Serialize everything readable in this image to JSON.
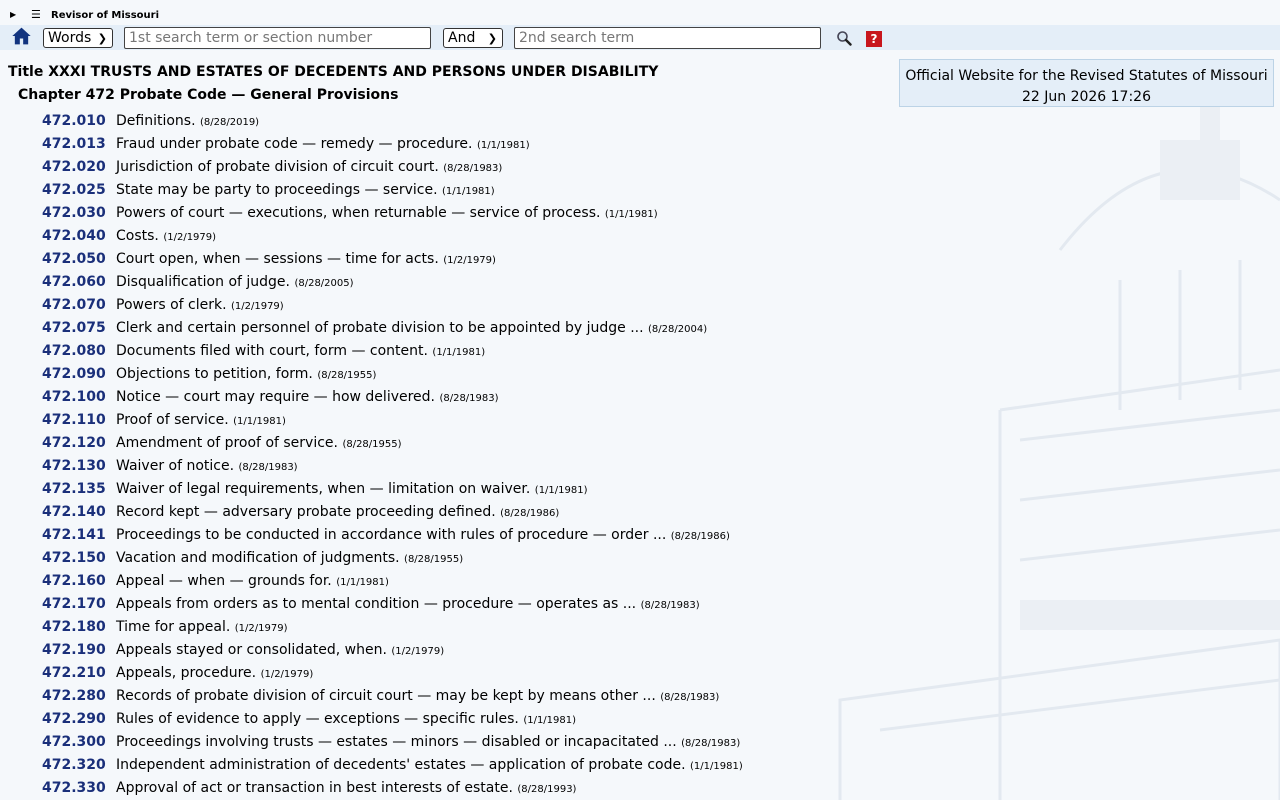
{
  "header": {
    "brand": "Revisor of Missouri"
  },
  "search": {
    "mode_selected": "Words",
    "term1_placeholder": "1st search term or section number",
    "connector_selected": "And",
    "term2_placeholder": "2nd search term",
    "help_label": "?"
  },
  "info": {
    "line1": "Official Website for the Revised Statutes of Missouri",
    "line2": "22 Jun 2026 17:26"
  },
  "title": "Title XXXI TRUSTS AND ESTATES OF DECEDENTS AND PERSONS UNDER DISABILITY",
  "chapter": "Chapter 472 Probate Code — General Provisions",
  "sections": [
    {
      "num": "472.010",
      "desc": "Definitions.",
      "date": "(8/28/2019)"
    },
    {
      "num": "472.013",
      "desc": "Fraud under probate code — remedy — procedure.",
      "date": "(1/1/1981)"
    },
    {
      "num": "472.020",
      "desc": "Jurisdiction of probate division of circuit court.",
      "date": "(8/28/1983)"
    },
    {
      "num": "472.025",
      "desc": "State may be party to proceedings — service.",
      "date": "(1/1/1981)"
    },
    {
      "num": "472.030",
      "desc": "Powers of court — executions, when returnable — service of process.",
      "date": "(1/1/1981)"
    },
    {
      "num": "472.040",
      "desc": "Costs.",
      "date": "(1/2/1979)"
    },
    {
      "num": "472.050",
      "desc": "Court open, when — sessions — time for acts.",
      "date": "(1/2/1979)"
    },
    {
      "num": "472.060",
      "desc": "Disqualification of judge.",
      "date": "(8/28/2005)"
    },
    {
      "num": "472.070",
      "desc": "Powers of clerk.",
      "date": "(1/2/1979)"
    },
    {
      "num": "472.075",
      "desc": "Clerk and certain personnel of probate division to be appointed by judge ...",
      "date": "(8/28/2004)"
    },
    {
      "num": "472.080",
      "desc": "Documents filed with court, form — content.",
      "date": "(1/1/1981)"
    },
    {
      "num": "472.090",
      "desc": "Objections to petition, form.",
      "date": "(8/28/1955)"
    },
    {
      "num": "472.100",
      "desc": "Notice — court may require — how delivered.",
      "date": "(8/28/1983)"
    },
    {
      "num": "472.110",
      "desc": "Proof of service.",
      "date": "(1/1/1981)"
    },
    {
      "num": "472.120",
      "desc": "Amendment of proof of service.",
      "date": "(8/28/1955)"
    },
    {
      "num": "472.130",
      "desc": "Waiver of notice.",
      "date": "(8/28/1983)"
    },
    {
      "num": "472.135",
      "desc": "Waiver of legal requirements, when — limitation on waiver.",
      "date": "(1/1/1981)"
    },
    {
      "num": "472.140",
      "desc": "Record kept — adversary probate proceeding defined.",
      "date": "(8/28/1986)"
    },
    {
      "num": "472.141",
      "desc": "Proceedings to be conducted in accordance with rules of procedure — order ...",
      "date": "(8/28/1986)"
    },
    {
      "num": "472.150",
      "desc": "Vacation and modification of judgments.",
      "date": "(8/28/1955)"
    },
    {
      "num": "472.160",
      "desc": "Appeal — when — grounds for.",
      "date": "(1/1/1981)"
    },
    {
      "num": "472.170",
      "desc": "Appeals from orders as to mental condition — procedure — operates as ...",
      "date": "(8/28/1983)"
    },
    {
      "num": "472.180",
      "desc": "Time for appeal.",
      "date": "(1/2/1979)"
    },
    {
      "num": "472.190",
      "desc": "Appeals stayed or consolidated, when.",
      "date": "(1/2/1979)"
    },
    {
      "num": "472.210",
      "desc": "Appeals, procedure.",
      "date": "(1/2/1979)"
    },
    {
      "num": "472.280",
      "desc": "Records of probate division of circuit court — may be kept by means other ...",
      "date": "(8/28/1983)"
    },
    {
      "num": "472.290",
      "desc": "Rules of evidence to apply — exceptions — specific rules.",
      "date": "(1/1/1981)"
    },
    {
      "num": "472.300",
      "desc": "Proceedings involving trusts — estates — minors — disabled or incapacitated ...",
      "date": "(8/28/1983)"
    },
    {
      "num": "472.320",
      "desc": "Independent administration of decedents' estates — application of probate code.",
      "date": "(1/1/1981)"
    },
    {
      "num": "472.330",
      "desc": "Approval of act or transaction in best interests of estate.",
      "date": "(8/28/1993)"
    }
  ]
}
